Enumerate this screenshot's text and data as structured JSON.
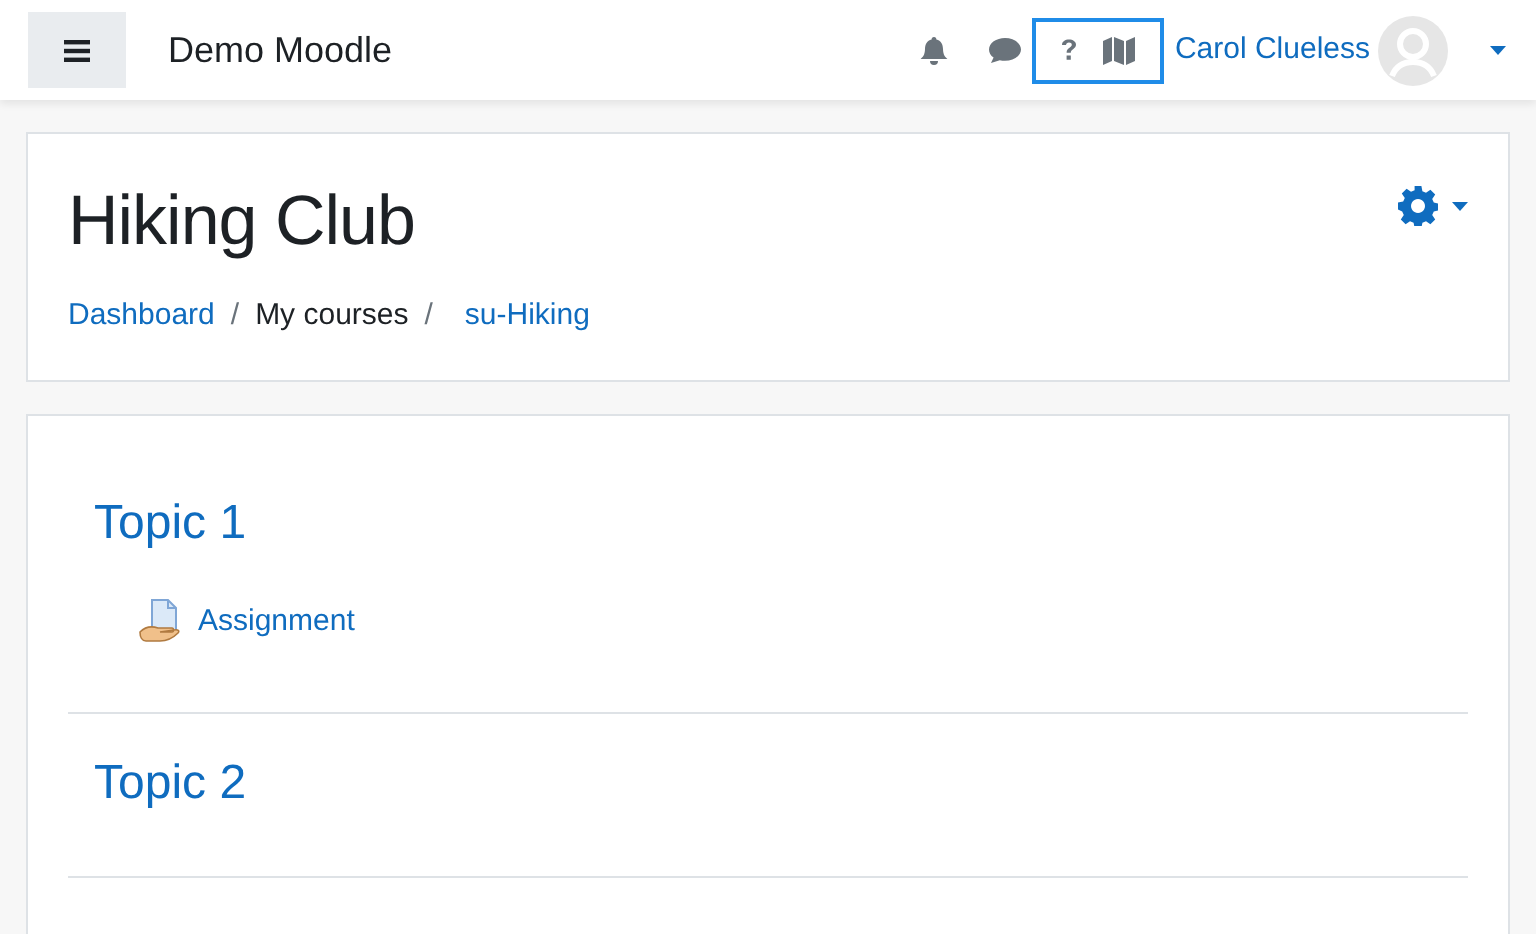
{
  "navbar": {
    "site_name": "Demo Moodle",
    "help_group_highlighted": true,
    "user_name": "Carol Clueless"
  },
  "header": {
    "title": "Hiking Club",
    "breadcrumb": [
      {
        "label": "Dashboard",
        "kind": "link"
      },
      {
        "label": "My courses",
        "kind": "text",
        "separator": "/"
      },
      {
        "label": "su-Hiking",
        "kind": "link",
        "separator": "/"
      }
    ]
  },
  "topics": [
    {
      "title": "Topic 1",
      "activities": [
        {
          "label": "Assignment"
        }
      ]
    },
    {
      "title": "Topic 2"
    }
  ]
}
